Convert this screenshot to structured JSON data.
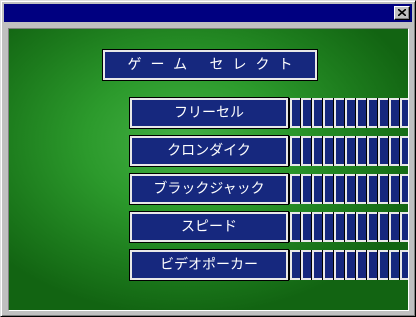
{
  "window": {
    "title": ""
  },
  "menu": {
    "title": "ゲーム セレクト",
    "items": [
      {
        "key": "freecell",
        "label": "フリーセル"
      },
      {
        "key": "klondike",
        "label": "クロンダイク"
      },
      {
        "key": "blackjack",
        "label": "ブラックジャック"
      },
      {
        "key": "speed",
        "label": "スピード"
      },
      {
        "key": "videopoker",
        "label": "ビデオポーカー"
      }
    ]
  },
  "colors": {
    "title_bar": "#000080",
    "button_fill": "#16287e",
    "felt": "#2c9a2c"
  },
  "icons": {
    "close": "close-icon"
  }
}
